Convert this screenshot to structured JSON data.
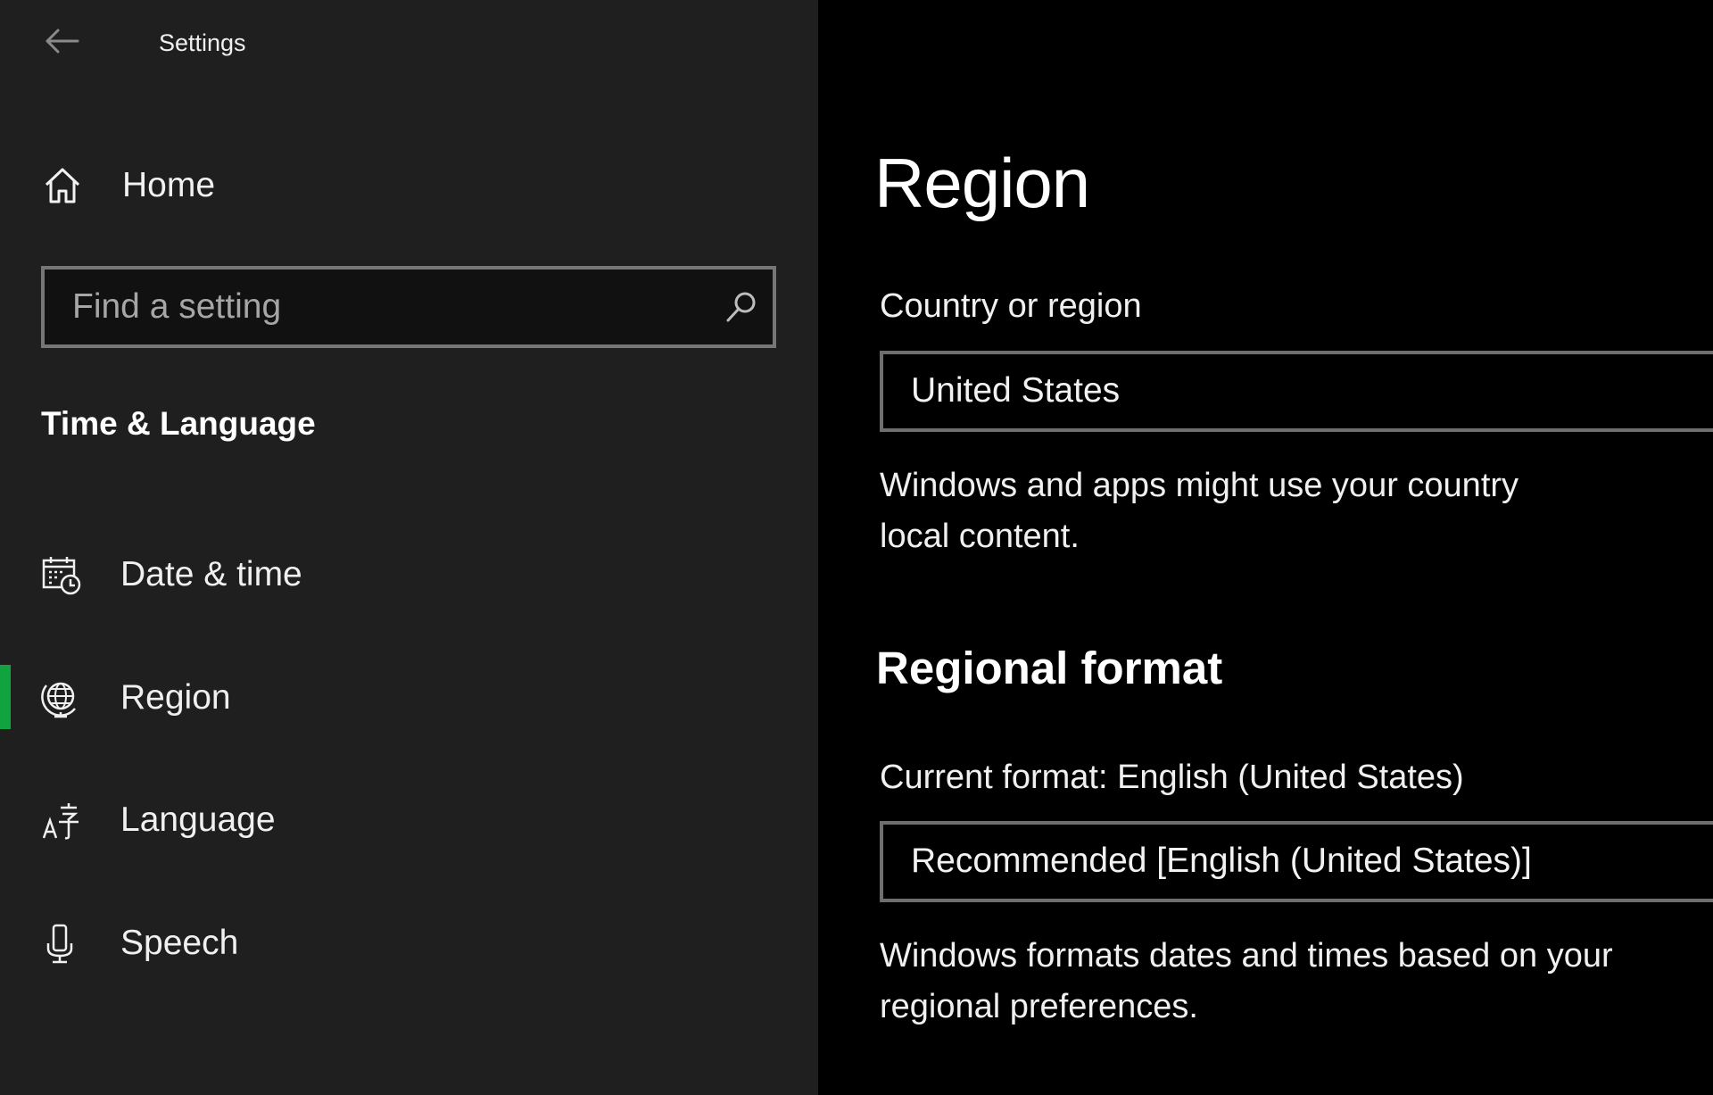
{
  "window": {
    "title": "Settings",
    "back_icon": "back-arrow-icon"
  },
  "sidebar": {
    "home": {
      "label": "Home",
      "icon": "home-icon"
    },
    "search": {
      "placeholder": "Find a setting",
      "value": "",
      "icon": "search-icon"
    },
    "section_title": "Time & Language",
    "items": [
      {
        "label": "Date & time",
        "icon": "calendar-clock-icon",
        "selected": false
      },
      {
        "label": "Region",
        "icon": "globe-icon",
        "selected": true
      },
      {
        "label": "Language",
        "icon": "language-icon",
        "selected": false
      },
      {
        "label": "Speech",
        "icon": "microphone-icon",
        "selected": false
      }
    ],
    "accent_color": "#10a33e"
  },
  "main": {
    "title": "Region",
    "country": {
      "label": "Country or region",
      "selected": "United States",
      "description_line1": "Windows and apps might use your country",
      "description_line2": "local content."
    },
    "regional_format": {
      "heading": "Regional format",
      "current_format_label": "Current format: English (United States)",
      "selected": "Recommended [English (United States)]",
      "description_line1": "Windows formats dates and times based on your",
      "description_line2": "regional preferences."
    }
  }
}
